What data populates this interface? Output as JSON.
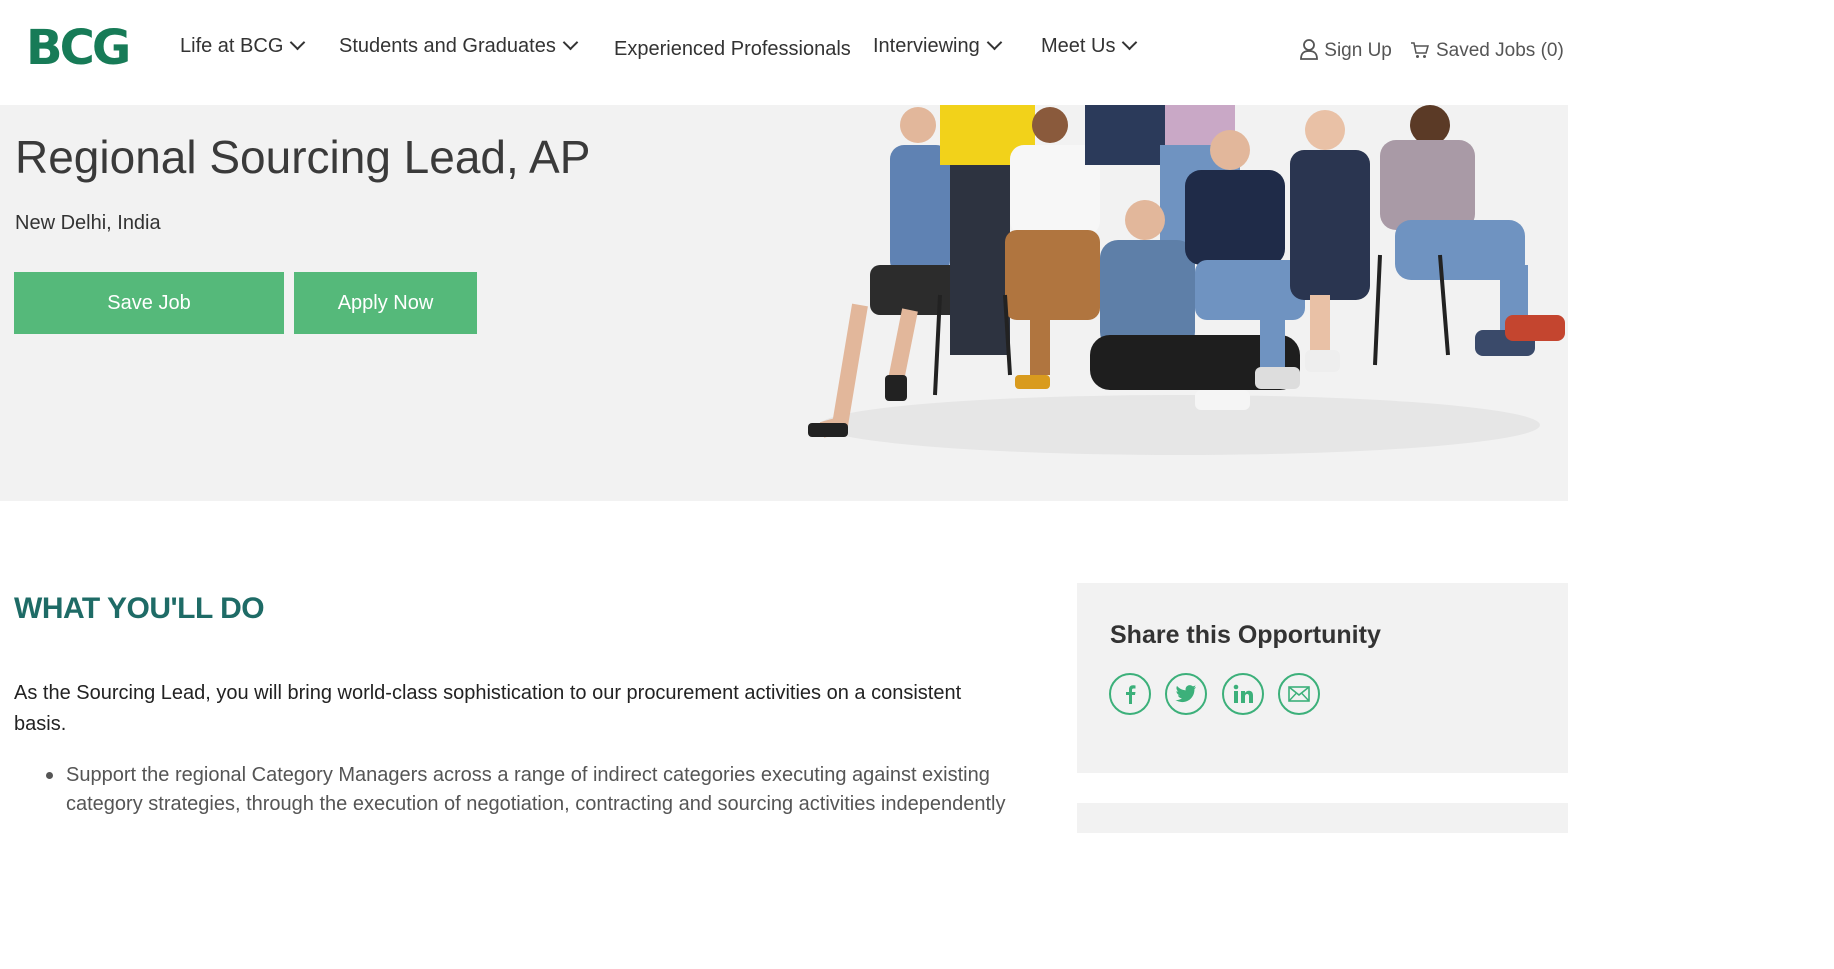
{
  "header": {
    "logo": "BCG",
    "nav": [
      {
        "label": "Life at BCG",
        "dropdown": true
      },
      {
        "label": "Students and Graduates",
        "dropdown": true
      },
      {
        "label": "Experienced Professionals",
        "dropdown": false
      },
      {
        "label": "Interviewing",
        "dropdown": true
      },
      {
        "label": "Meet Us",
        "dropdown": true
      }
    ],
    "sign_up": "Sign Up",
    "saved_jobs": "Saved Jobs (0)"
  },
  "job": {
    "title": "Regional Sourcing Lead, AP",
    "location": "New Delhi, India",
    "save_label": "Save Job",
    "apply_label": "Apply Now"
  },
  "content": {
    "section_title": "WHAT YOU'LL DO",
    "intro": "As the Sourcing Lead, you will bring world-class sophistication to our procurement activities on a consistent basis.",
    "bullets": [
      "Support the regional Category Managers across a range of indirect categories executing against existing category strategies, through the execution of negotiation, contracting and sourcing activities independently"
    ]
  },
  "share": {
    "title": "Share this Opportunity",
    "icons": [
      "facebook-icon",
      "twitter-icon",
      "linkedin-icon",
      "email-icon"
    ]
  },
  "colors": {
    "brand_green": "#177b57",
    "button_green": "#55b97a",
    "heading_teal": "#1e6b66",
    "hero_bg": "#f2f2f2"
  }
}
